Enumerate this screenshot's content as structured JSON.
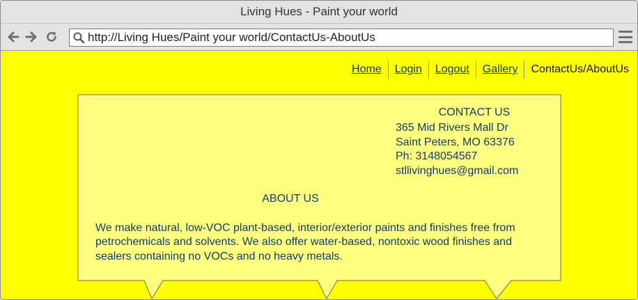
{
  "window": {
    "title": "Living Hues - Paint your world"
  },
  "browser": {
    "url": "http://Living Hues/Paint your world/ContactUs-AboutUs",
    "back_icon": "arrow-left-icon",
    "forward_icon": "arrow-right-icon",
    "reload_icon": "reload-icon",
    "menu_icon": "hamburger-menu-icon"
  },
  "nav": {
    "home": "Home",
    "login": "Login",
    "logout": "Logout",
    "gallery": "Gallery",
    "current": "ContactUs/AboutUs"
  },
  "contact": {
    "title": "CONTACT US",
    "address_line1": "365 Mid Rivers Mall Dr",
    "address_line2": "Saint Peters, MO 63376",
    "phone": "Ph: 3148054567",
    "email": "stllivinghues@gmail.com"
  },
  "about": {
    "title": "ABOUT US",
    "text": "We make natural, low-VOC plant-based, interior/exterior paints and finishes free from petrochemicals and solvents. We also offer water-based, nontoxic wood finishes and sealers containing no VOCs and no heavy metals."
  },
  "colors": {
    "page_background": "#ffff00",
    "panel_background": "#ffff80",
    "text": "#0d3f6a",
    "chrome": "#e3e3e3"
  }
}
